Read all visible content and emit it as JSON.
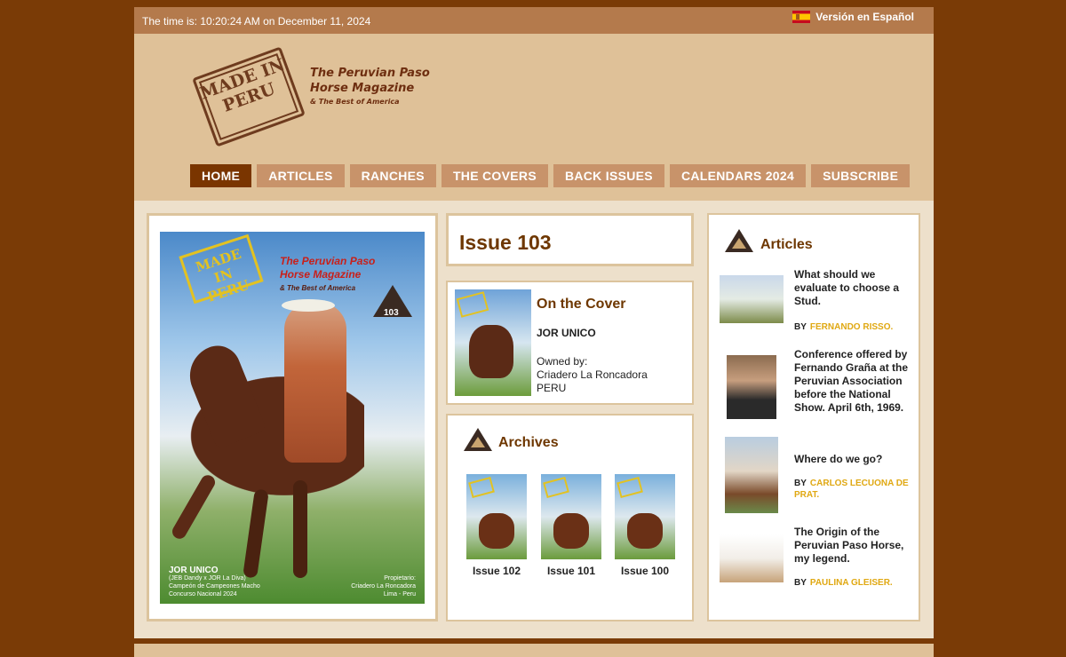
{
  "topbar": {
    "time_text": "The time is: 10:20:24 AM on December 11, 2024",
    "language_link": "Versión en Español"
  },
  "logo": {
    "stamp_line1": "MADE IN",
    "stamp_line2": "PERU",
    "title_line1": "The Peruvian Paso",
    "title_line2": "Horse Magazine",
    "title_line3": "& The Best of America"
  },
  "nav": {
    "items": [
      "HOME",
      "ARTICLES",
      "RANCHES",
      "THE COVERS",
      "BACK ISSUES",
      "CALENDARS 2024",
      "SUBSCRIBE"
    ],
    "active": "HOME"
  },
  "cover": {
    "stamp_line1": "MADE IN",
    "stamp_line2": "PERU",
    "title_line1": "The Peruvian Paso",
    "title_line2": "Horse Magazine",
    "title_line3": "& The Best of America",
    "issue_number": "103",
    "caption_name": "JOR UNICO",
    "caption_line2": "(JEB Dandy x JOR La Diva)",
    "caption_line3": "Campeón de Campeones Macho",
    "caption_line4": "Concurso Nacional 2024",
    "owner_line1": "Propietario:",
    "owner_line2": "Criadero La Roncadora",
    "owner_line3": "Lima - Peru"
  },
  "issue": {
    "title": "Issue 103"
  },
  "on_the_cover": {
    "heading": "On the Cover",
    "horse_name": "JOR UNICO",
    "owned_label": "Owned by:",
    "owner_name": "Criadero La Roncadora",
    "owner_country": "PERU"
  },
  "archives": {
    "heading": "Archives",
    "items": [
      {
        "label": "Issue 102"
      },
      {
        "label": "Issue 101"
      },
      {
        "label": "Issue 100"
      }
    ]
  },
  "articles": {
    "heading": "Articles",
    "items": [
      {
        "title": "What should we evaluate to choose a Stud.",
        "by_label": "BY",
        "author": "FERNANDO RISSO."
      },
      {
        "title": "Conference offered by Fernando Graña at the Peruvian Association before the National Show. April 6th, 1969.",
        "by_label": "",
        "author": ""
      },
      {
        "title": "Where do we go?",
        "by_label": "BY",
        "author": "CARLOS LECUONA DE PRAT."
      },
      {
        "title": "The Origin of the Peruvian Paso Horse, my legend.",
        "by_label": "BY",
        "author": "PAULINA GLEISER."
      }
    ]
  },
  "colors": {
    "outer_bg": "#7a3b06",
    "header_bg": "#dfc198",
    "topbar_bg": "#b47a4c",
    "nav_bg": "#c8936a",
    "nav_active_bg": "#7a3500",
    "heading_color": "#6e3700",
    "author_color": "#e0a812"
  }
}
